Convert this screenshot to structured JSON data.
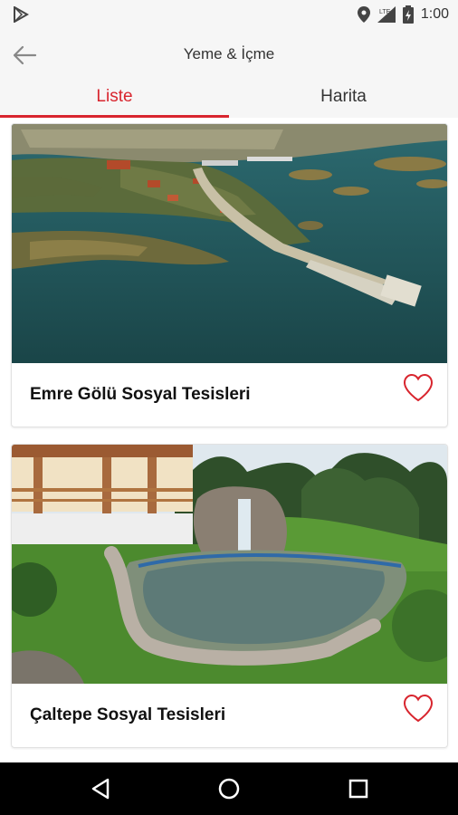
{
  "status_bar": {
    "time": "1:00",
    "icons": [
      "play-store-icon",
      "location-icon",
      "signal-icon",
      "battery-icon"
    ]
  },
  "app_bar": {
    "title": "Yeme & İçme",
    "back_icon": "arrow-left-icon"
  },
  "tabs": [
    {
      "label": "Liste",
      "active": true
    },
    {
      "label": "Harita",
      "active": false
    }
  ],
  "places": [
    {
      "name": "Emre Gölü Sosyal Tesisleri",
      "favorite": false
    },
    {
      "name": "Çaltepe Sosyal Tesisleri",
      "favorite": false
    }
  ],
  "nav_bar": {
    "icons": [
      "back-triangle-icon",
      "home-circle-icon",
      "recents-square-icon"
    ]
  },
  "colors": {
    "accent": "#d8252e",
    "bar": "#f6f6f6"
  }
}
